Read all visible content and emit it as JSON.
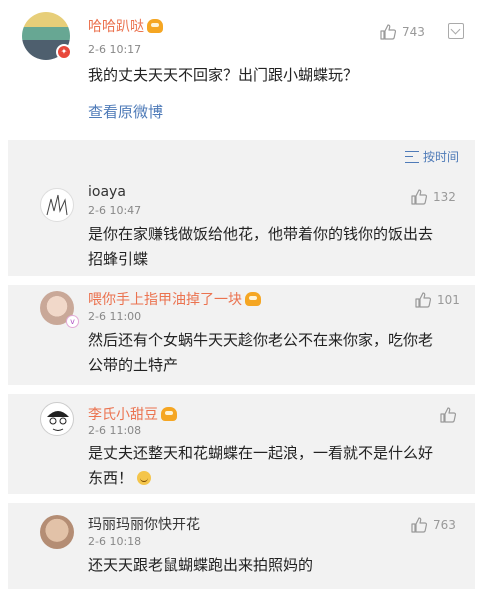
{
  "main": {
    "author": "哈哈趴哒",
    "time": "2-6 10:17",
    "likes": "743",
    "text": "我的丈夫天天不回家？出门跟小蝴蝶玩？",
    "view_original": "查看原微博"
  },
  "sort": {
    "label": "按时间",
    "icon": "sort-icon"
  },
  "comments": [
    {
      "author": "ioaya",
      "time": "2-6 10:47",
      "likes": "132",
      "text_line1": "是你在家赚钱做饭给他花，他带着你的钱你的饭出去",
      "text_line2": "招蜂引蝶"
    },
    {
      "author": "喂你手上指甲油掉了一块",
      "time": "2-6 11:00",
      "likes": "101",
      "text_line1": "然后还有个女蜗牛天天趁你老公不在来你家，吃你老",
      "text_line2": "公带的土特产"
    },
    {
      "author": "李氏小甜豆",
      "time": "2-6 11:08",
      "likes": "",
      "text_line1": "是丈夫还整天和花蝴蝶在一起浪，一看就不是什么好",
      "text_line2": "东西！"
    },
    {
      "author": "玛丽玛丽你快开花",
      "time": "2-6 10:18",
      "likes": "763",
      "text_line1": "还天天跟老鼠蝴蝶跑出来拍照妈的"
    }
  ],
  "colors": {
    "link": "#4f7bb8",
    "name_highlight": "#eb7350",
    "card_bg": "#f2f2f2"
  }
}
